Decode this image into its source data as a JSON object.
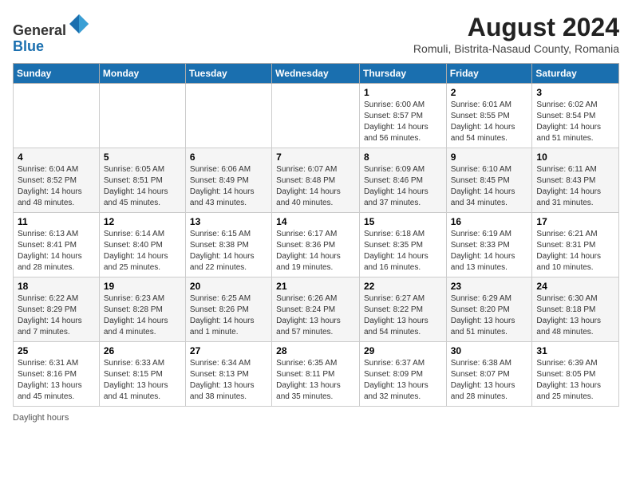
{
  "header": {
    "logo_general": "General",
    "logo_blue": "Blue",
    "month_year": "August 2024",
    "location": "Romuli, Bistrita-Nasaud County, Romania"
  },
  "days_of_week": [
    "Sunday",
    "Monday",
    "Tuesday",
    "Wednesday",
    "Thursday",
    "Friday",
    "Saturday"
  ],
  "weeks": [
    [
      {
        "day": "",
        "info": ""
      },
      {
        "day": "",
        "info": ""
      },
      {
        "day": "",
        "info": ""
      },
      {
        "day": "",
        "info": ""
      },
      {
        "day": "1",
        "info": "Sunrise: 6:00 AM\nSunset: 8:57 PM\nDaylight: 14 hours and 56 minutes."
      },
      {
        "day": "2",
        "info": "Sunrise: 6:01 AM\nSunset: 8:55 PM\nDaylight: 14 hours and 54 minutes."
      },
      {
        "day": "3",
        "info": "Sunrise: 6:02 AM\nSunset: 8:54 PM\nDaylight: 14 hours and 51 minutes."
      }
    ],
    [
      {
        "day": "4",
        "info": "Sunrise: 6:04 AM\nSunset: 8:52 PM\nDaylight: 14 hours and 48 minutes."
      },
      {
        "day": "5",
        "info": "Sunrise: 6:05 AM\nSunset: 8:51 PM\nDaylight: 14 hours and 45 minutes."
      },
      {
        "day": "6",
        "info": "Sunrise: 6:06 AM\nSunset: 8:49 PM\nDaylight: 14 hours and 43 minutes."
      },
      {
        "day": "7",
        "info": "Sunrise: 6:07 AM\nSunset: 8:48 PM\nDaylight: 14 hours and 40 minutes."
      },
      {
        "day": "8",
        "info": "Sunrise: 6:09 AM\nSunset: 8:46 PM\nDaylight: 14 hours and 37 minutes."
      },
      {
        "day": "9",
        "info": "Sunrise: 6:10 AM\nSunset: 8:45 PM\nDaylight: 14 hours and 34 minutes."
      },
      {
        "day": "10",
        "info": "Sunrise: 6:11 AM\nSunset: 8:43 PM\nDaylight: 14 hours and 31 minutes."
      }
    ],
    [
      {
        "day": "11",
        "info": "Sunrise: 6:13 AM\nSunset: 8:41 PM\nDaylight: 14 hours and 28 minutes."
      },
      {
        "day": "12",
        "info": "Sunrise: 6:14 AM\nSunset: 8:40 PM\nDaylight: 14 hours and 25 minutes."
      },
      {
        "day": "13",
        "info": "Sunrise: 6:15 AM\nSunset: 8:38 PM\nDaylight: 14 hours and 22 minutes."
      },
      {
        "day": "14",
        "info": "Sunrise: 6:17 AM\nSunset: 8:36 PM\nDaylight: 14 hours and 19 minutes."
      },
      {
        "day": "15",
        "info": "Sunrise: 6:18 AM\nSunset: 8:35 PM\nDaylight: 14 hours and 16 minutes."
      },
      {
        "day": "16",
        "info": "Sunrise: 6:19 AM\nSunset: 8:33 PM\nDaylight: 14 hours and 13 minutes."
      },
      {
        "day": "17",
        "info": "Sunrise: 6:21 AM\nSunset: 8:31 PM\nDaylight: 14 hours and 10 minutes."
      }
    ],
    [
      {
        "day": "18",
        "info": "Sunrise: 6:22 AM\nSunset: 8:29 PM\nDaylight: 14 hours and 7 minutes."
      },
      {
        "day": "19",
        "info": "Sunrise: 6:23 AM\nSunset: 8:28 PM\nDaylight: 14 hours and 4 minutes."
      },
      {
        "day": "20",
        "info": "Sunrise: 6:25 AM\nSunset: 8:26 PM\nDaylight: 14 hours and 1 minute."
      },
      {
        "day": "21",
        "info": "Sunrise: 6:26 AM\nSunset: 8:24 PM\nDaylight: 13 hours and 57 minutes."
      },
      {
        "day": "22",
        "info": "Sunrise: 6:27 AM\nSunset: 8:22 PM\nDaylight: 13 hours and 54 minutes."
      },
      {
        "day": "23",
        "info": "Sunrise: 6:29 AM\nSunset: 8:20 PM\nDaylight: 13 hours and 51 minutes."
      },
      {
        "day": "24",
        "info": "Sunrise: 6:30 AM\nSunset: 8:18 PM\nDaylight: 13 hours and 48 minutes."
      }
    ],
    [
      {
        "day": "25",
        "info": "Sunrise: 6:31 AM\nSunset: 8:16 PM\nDaylight: 13 hours and 45 minutes."
      },
      {
        "day": "26",
        "info": "Sunrise: 6:33 AM\nSunset: 8:15 PM\nDaylight: 13 hours and 41 minutes."
      },
      {
        "day": "27",
        "info": "Sunrise: 6:34 AM\nSunset: 8:13 PM\nDaylight: 13 hours and 38 minutes."
      },
      {
        "day": "28",
        "info": "Sunrise: 6:35 AM\nSunset: 8:11 PM\nDaylight: 13 hours and 35 minutes."
      },
      {
        "day": "29",
        "info": "Sunrise: 6:37 AM\nSunset: 8:09 PM\nDaylight: 13 hours and 32 minutes."
      },
      {
        "day": "30",
        "info": "Sunrise: 6:38 AM\nSunset: 8:07 PM\nDaylight: 13 hours and 28 minutes."
      },
      {
        "day": "31",
        "info": "Sunrise: 6:39 AM\nSunset: 8:05 PM\nDaylight: 13 hours and 25 minutes."
      }
    ]
  ],
  "footer": {
    "daylight_hours_label": "Daylight hours"
  }
}
